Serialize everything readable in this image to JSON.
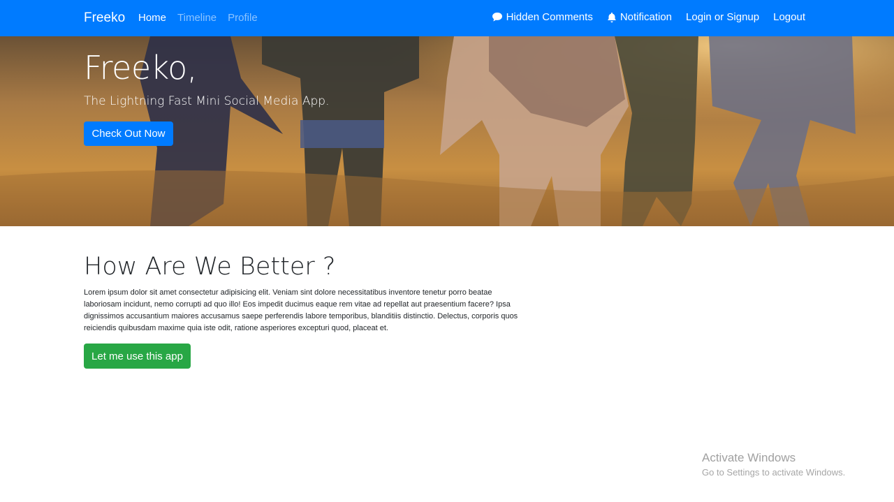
{
  "navbar": {
    "brand": "Freeko",
    "left_links": [
      {
        "label": "Home",
        "active": true
      },
      {
        "label": "Timeline",
        "active": false
      },
      {
        "label": "Profile",
        "active": false
      }
    ],
    "right_links": {
      "hidden_comments": {
        "label": "Hidden Comments",
        "icon": "comment-icon"
      },
      "notification": {
        "label": "Notification",
        "icon": "bell-icon"
      },
      "login": {
        "label": "Login or Signup"
      },
      "logout": {
        "label": "Logout"
      }
    },
    "color": "#007bff"
  },
  "hero": {
    "title": "Freeko,",
    "subtitle": "The Lightning Fast Mini Social Media App.",
    "cta_label": "Check Out Now"
  },
  "main": {
    "heading": "How Are We Better ?",
    "body": "Lorem ipsum dolor sit amet consectetur adipisicing elit. Veniam sint dolore necessitatibus inventore tenetur porro beatae laboriosam incidunt, nemo corrupti ad quo illo! Eos impedit ducimus eaque rem vitae ad repellat aut praesentium facere? Ipsa dignissimos accusantium maiores accusamus saepe perferendis labore temporibus, blanditiis distinctio. Delectus, corporis quos reiciendis quibusdam maxime quia iste odit, ratione asperiores excepturi quod, placeat et.",
    "cta_label": "Let me use this app",
    "cta_color": "#28a745"
  },
  "watermark": {
    "title": "Activate Windows",
    "subtitle": "Go to Settings to activate Windows."
  }
}
